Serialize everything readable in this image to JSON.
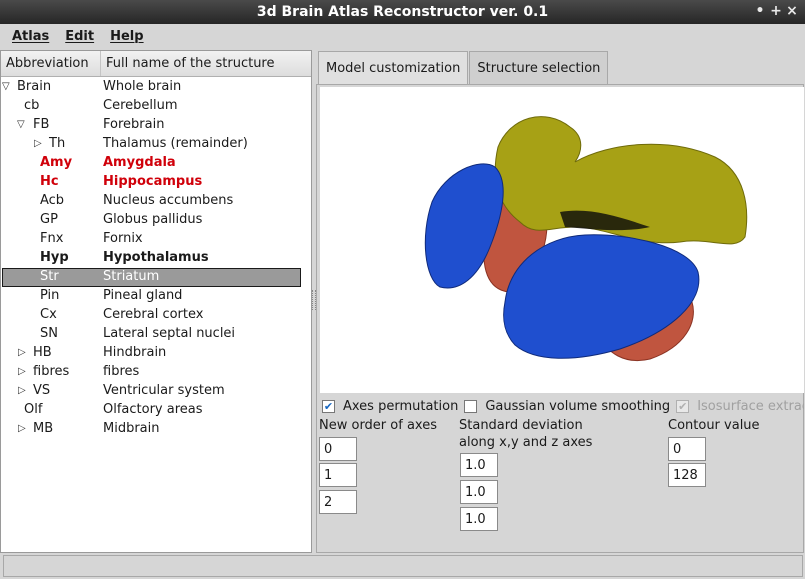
{
  "window": {
    "title": "3d Brain Atlas Reconstructor ver. 0.1",
    "controls": [
      "•",
      "+",
      "×"
    ]
  },
  "menubar": {
    "items": [
      "Atlas",
      "Edit",
      "Help"
    ]
  },
  "tree": {
    "headers": {
      "abbreviation": "Abbreviation",
      "full_name": "Full name of the structure"
    },
    "rows": [
      {
        "abbr": "Brain",
        "name": "Whole brain",
        "expander": "▽"
      },
      {
        "abbr": "cb",
        "name": "Cerebellum",
        "expander": ""
      },
      {
        "abbr": "FB",
        "name": "Forebrain",
        "expander": "▽"
      },
      {
        "abbr": "Th",
        "name": "Thalamus (remainder)",
        "expander": "▷"
      },
      {
        "abbr": "Amy",
        "name": "Amygdala",
        "expander": ""
      },
      {
        "abbr": "Hc",
        "name": "Hippocampus",
        "expander": ""
      },
      {
        "abbr": "Acb",
        "name": "Nucleus accumbens",
        "expander": ""
      },
      {
        "abbr": "GP",
        "name": "Globus pallidus",
        "expander": ""
      },
      {
        "abbr": "Fnx",
        "name": "Fornix",
        "expander": ""
      },
      {
        "abbr": "Hyp",
        "name": "Hypothalamus",
        "expander": ""
      },
      {
        "abbr": "Str",
        "name": "Striatum",
        "expander": ""
      },
      {
        "abbr": "Pin",
        "name": "Pineal gland",
        "expander": ""
      },
      {
        "abbr": "Cx",
        "name": "Cerebral cortex",
        "expander": ""
      },
      {
        "abbr": "SN",
        "name": "Lateral septal nuclei",
        "expander": ""
      },
      {
        "abbr": "HB",
        "name": "Hindbrain",
        "expander": "▷"
      },
      {
        "abbr": "fibres",
        "name": "fibres",
        "expander": "▷"
      },
      {
        "abbr": "VS",
        "name": "Ventricular system",
        "expander": "▷"
      },
      {
        "abbr": "Olf",
        "name": "Olfactory areas",
        "expander": ""
      },
      {
        "abbr": "MB",
        "name": "Midbrain",
        "expander": "▷"
      }
    ]
  },
  "tabs": [
    "Model customization",
    "Structure selection"
  ],
  "options": {
    "axes_permutation": "Axes permutation",
    "axes_check": "✔",
    "gaussian_smoothing": "Gaussian volume smoothing",
    "isosurface": "Isosurface extrac",
    "isosurface_check": "✔"
  },
  "axes": {
    "label": "New order of axes",
    "values": [
      "0",
      "1",
      "2"
    ]
  },
  "stddev": {
    "label_line1": "Standard deviation",
    "label_line2": "along x,y and z axes",
    "values": [
      "1.0",
      "1.0",
      "1.0"
    ]
  },
  "contour": {
    "label": "Contour value",
    "values": [
      "0",
      "128"
    ]
  },
  "colors": {
    "highlight_red": "#d0000a",
    "selection_gray": "#9a9a9a",
    "structure_olive": "#a7a115",
    "structure_blue": "#1f4fcf",
    "structure_red": "#c0553f"
  }
}
